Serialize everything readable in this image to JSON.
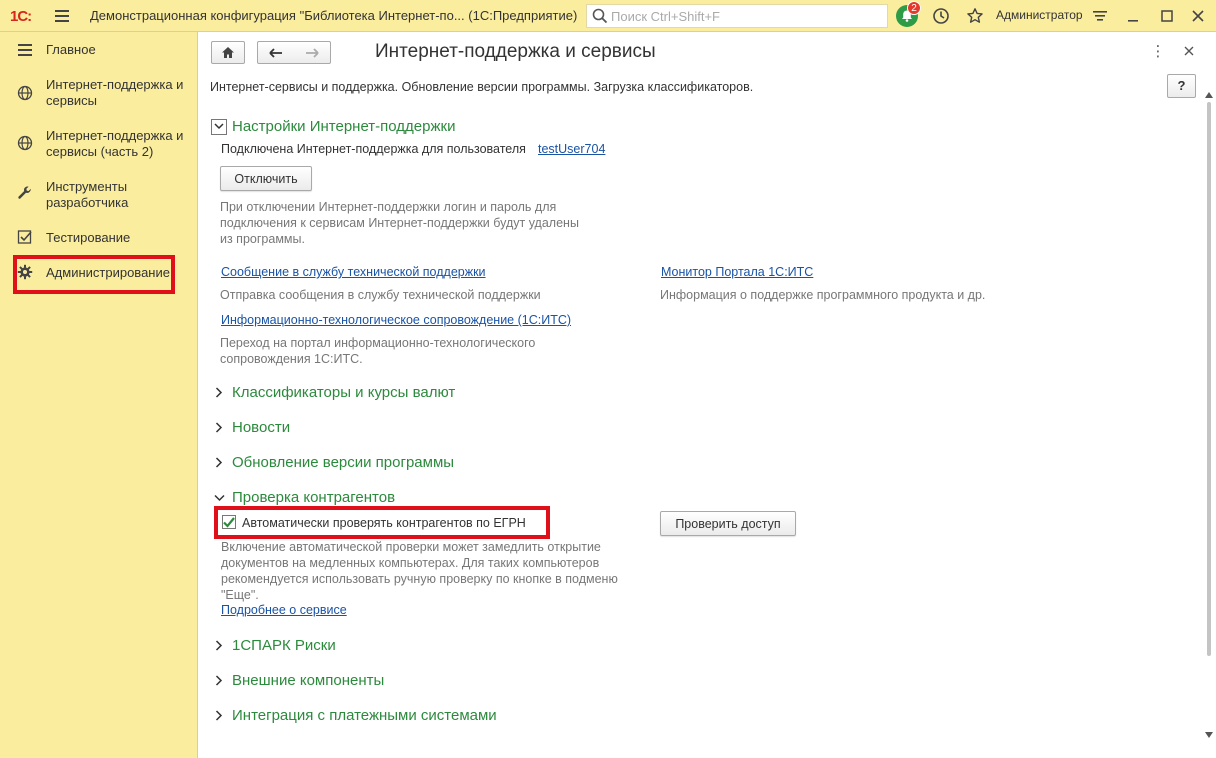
{
  "app": {
    "logo": "1С:",
    "window_title": "Демонстрационная конфигурация \"Библиотека Интернет-по...   (1С:Предприятие)",
    "search_placeholder": "Поиск Ctrl+Shift+F",
    "notifications_count": "2",
    "user_name": "Администратор",
    "colors": {
      "panel": "#fbed9e",
      "accent_green": "#2c8a3d",
      "link": "#1a53a4",
      "highlight_red": "#e0101a"
    }
  },
  "sidebar": {
    "items": [
      {
        "label": "Главное",
        "icon": "menu-lines-icon"
      },
      {
        "label": "Интернет-поддержка и сервисы",
        "icon": "globe-icon"
      },
      {
        "label": "Интернет-поддержка и сервисы (часть 2)",
        "icon": "globe-icon"
      },
      {
        "label": "Инструменты разработчика",
        "icon": "wrench-icon"
      },
      {
        "label": "Тестирование",
        "icon": "checkbox-icon"
      },
      {
        "label": "Администрирование",
        "icon": "gear-icon"
      }
    ]
  },
  "form": {
    "title": "Интернет-поддержка и сервисы",
    "description": "Интернет-сервисы и поддержка. Обновление версии программы. Загрузка классификаторов.",
    "help_label": "?",
    "sections": {
      "settings": {
        "label": "Настройки Интернет-поддержки",
        "connected_text": "Подключена Интернет-поддержка для пользователя",
        "user_link": "testUser704",
        "disconnect_button": "Отключить",
        "disconnect_note": "При отключении Интернет-поддержки логин и пароль для подключения к сервисам Интернет-поддержки будут удалены из программы.",
        "support_link": "Сообщение в службу технической поддержки",
        "support_note": "Отправка сообщения в службу технической поддержки",
        "monitor_link": "Монитор Портала 1С:ИТС",
        "monitor_note": "Информация о поддержке программного продукта и др.",
        "its_link": "Информационно-технологическое сопровождение (1С:ИТС)",
        "its_note": "Переход на портал информационно-технологического сопровождения 1С:ИТС."
      },
      "classifiers": {
        "label": "Классификаторы и курсы валют"
      },
      "news": {
        "label": "Новости"
      },
      "update": {
        "label": "Обновление версии программы"
      },
      "counterparty": {
        "label": "Проверка контрагентов",
        "checkbox_label": "Автоматически проверять контрагентов по ЕГРН",
        "checkbox_checked": true,
        "check_access_button": "Проверить доступ",
        "note": "Включение автоматической проверки может замедлить открытие документов на медленных компьютерах. Для таких компьютеров рекомендуется использовать ручную проверку по кнопке в подменю \"Еще\".",
        "more_link": "Подробнее о сервисе"
      },
      "spark": {
        "label": "1СПАРК Риски"
      },
      "external": {
        "label": "Внешние компоненты"
      },
      "payments": {
        "label": "Интеграция с платежными системами"
      }
    }
  }
}
